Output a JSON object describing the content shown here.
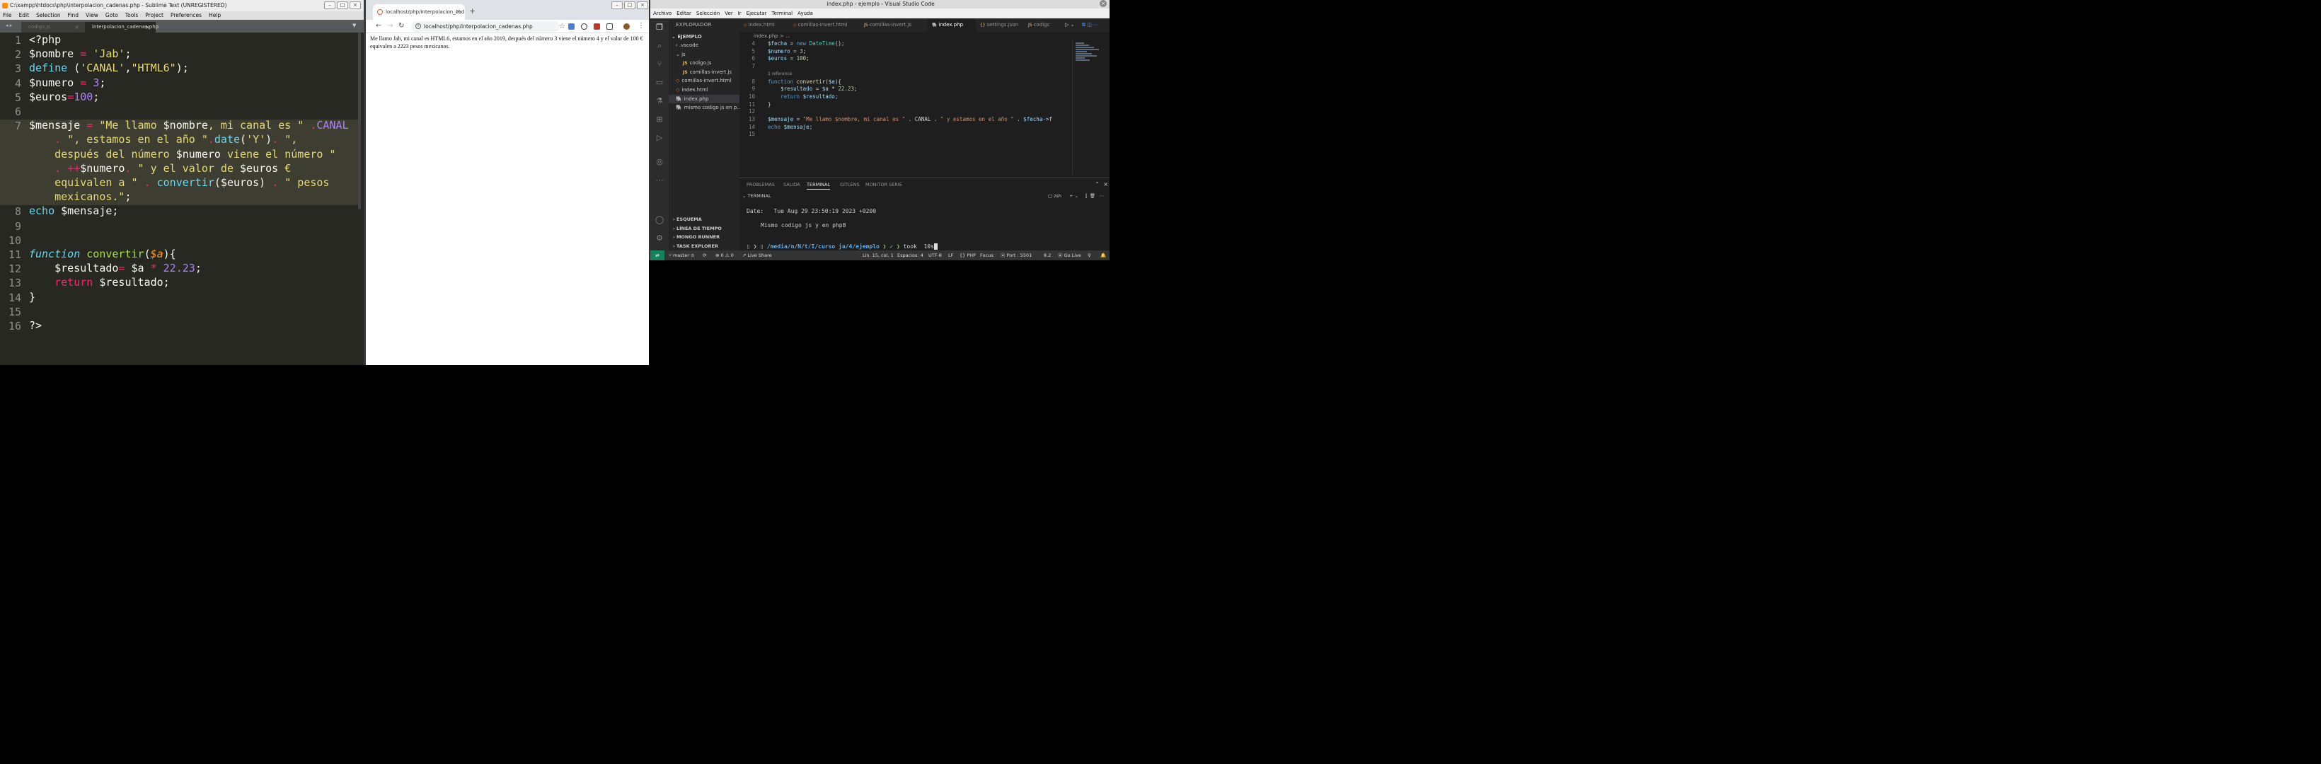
{
  "sublime": {
    "title": "C:\\xampp\\htdocs\\php\\interpolacion_cadenas.php - Sublime Text (UNREGISTERED)",
    "menu": [
      "File",
      "Edit",
      "Selection",
      "Find",
      "View",
      "Goto",
      "Tools",
      "Project",
      "Preferences",
      "Help"
    ],
    "tabs": [
      {
        "label": "codigo.js",
        "active": false
      },
      {
        "label": "interpolacion_cadenas.php",
        "active": true
      }
    ],
    "lines": [
      {
        "n": "1",
        "rows": [
          [
            [
              "v",
              "<?php"
            ]
          ]
        ]
      },
      {
        "n": "2",
        "rows": [
          [
            [
              "v",
              "$nombre "
            ],
            [
              "o",
              "="
            ],
            [
              "v",
              " "
            ],
            [
              "s",
              "'Jab'"
            ],
            [
              "v",
              ";"
            ]
          ]
        ]
      },
      {
        "n": "3",
        "rows": [
          [
            [
              "f",
              "define"
            ],
            [
              "v",
              " ("
            ],
            [
              "s",
              "'CANAL'"
            ],
            [
              "v",
              ","
            ],
            [
              "s",
              "\"HTML6\""
            ],
            [
              "v",
              ");"
            ]
          ]
        ]
      },
      {
        "n": "4",
        "rows": [
          [
            [
              "v",
              "$numero "
            ],
            [
              "o",
              "="
            ],
            [
              "v",
              " "
            ],
            [
              "c",
              "3"
            ],
            [
              "v",
              ";"
            ]
          ]
        ]
      },
      {
        "n": "5",
        "rows": [
          [
            [
              "v",
              "$euros"
            ],
            [
              "o",
              "="
            ],
            [
              "c",
              "100"
            ],
            [
              "v",
              ";"
            ]
          ]
        ]
      },
      {
        "n": "6",
        "rows": [
          [
            [
              "v",
              ""
            ]
          ]
        ]
      },
      {
        "n": "7",
        "rows": [
          [
            [
              "v",
              "$mensaje "
            ],
            [
              "o",
              "="
            ],
            [
              "v",
              " "
            ],
            [
              "s",
              "\"Me llamo "
            ],
            [
              "v",
              "$nombre"
            ],
            [
              "s",
              ", mi canal es \""
            ],
            [
              "v",
              " "
            ],
            [
              "o",
              "."
            ],
            [
              "c",
              "CANAL"
            ]
          ],
          [
            [
              "v",
              "    "
            ],
            [
              "o",
              "."
            ],
            [
              "v",
              " "
            ],
            [
              "s",
              "\", estamos en el año \""
            ],
            [
              "o",
              "."
            ],
            [
              "f",
              "date"
            ],
            [
              "v",
              "("
            ],
            [
              "s",
              "'Y'"
            ],
            [
              "v",
              ")"
            ],
            [
              "o",
              "."
            ],
            [
              "v",
              " "
            ],
            [
              "s",
              "\","
            ]
          ],
          [
            [
              "s",
              "    después del número "
            ],
            [
              "v",
              "$numero"
            ],
            [
              "s",
              " viene el número \""
            ]
          ],
          [
            [
              "v",
              "    "
            ],
            [
              "o",
              "."
            ],
            [
              "v",
              " "
            ],
            [
              "o",
              "++"
            ],
            [
              "v",
              "$numero"
            ],
            [
              "o",
              "."
            ],
            [
              "v",
              " "
            ],
            [
              "s",
              "\" y el valor de "
            ],
            [
              "v",
              "$euros"
            ],
            [
              "s",
              " €"
            ]
          ],
          [
            [
              "s",
              "    equivalen a \""
            ],
            [
              "v",
              " "
            ],
            [
              "o",
              "."
            ],
            [
              "v",
              " "
            ],
            [
              "f",
              "convertir"
            ],
            [
              "v",
              "($euros) "
            ],
            [
              "o",
              "."
            ],
            [
              "v",
              " "
            ],
            [
              "s",
              "\" pesos"
            ]
          ],
          [
            [
              "s",
              "    mexicanos.\""
            ],
            [
              "v",
              ";"
            ]
          ]
        ]
      },
      {
        "n": "8",
        "rows": [
          [
            [
              "f",
              "echo"
            ],
            [
              "v",
              " $mensaje;"
            ]
          ]
        ]
      },
      {
        "n": "9",
        "rows": [
          [
            [
              "v",
              ""
            ]
          ]
        ]
      },
      {
        "n": "10",
        "rows": [
          [
            [
              "v",
              ""
            ]
          ]
        ]
      },
      {
        "n": "11",
        "rows": [
          [
            [
              "fi",
              "function"
            ],
            [
              "v",
              " "
            ],
            [
              "g",
              "convertir"
            ],
            [
              "v",
              "("
            ],
            [
              "pa",
              "$a"
            ],
            [
              "v",
              "){"
            ]
          ]
        ]
      },
      {
        "n": "12",
        "rows": [
          [
            [
              "v",
              "    $resultado"
            ],
            [
              "o",
              "="
            ],
            [
              "v",
              " $a "
            ],
            [
              "o",
              "*"
            ],
            [
              "v",
              " "
            ],
            [
              "c",
              "22.23"
            ],
            [
              "v",
              ";"
            ]
          ]
        ]
      },
      {
        "n": "13",
        "rows": [
          [
            [
              "v",
              "    "
            ],
            [
              "k",
              "return"
            ],
            [
              "v",
              " $resultado;"
            ]
          ]
        ]
      },
      {
        "n": "14",
        "rows": [
          [
            [
              "v",
              "}"
            ]
          ]
        ]
      },
      {
        "n": "15",
        "rows": [
          [
            [
              "v",
              ""
            ]
          ]
        ]
      },
      {
        "n": "16",
        "rows": [
          [
            [
              "v",
              "?>"
            ]
          ]
        ]
      }
    ]
  },
  "browser": {
    "tab_title": "localhost/php/interpolacion_cad",
    "url": "localhost/php/interpolacion_cadenas.php",
    "page_text": "Me llamo Jab, mi canal es HTML6, estamos en el año 2019, después del número 3 viene el número 4 y el valor de 100 € equivalen a 2223 pesos mexicanos."
  },
  "vscode": {
    "title": "index.php - ejemplo - Visual Studio Code",
    "menu": [
      "Archivo",
      "Editar",
      "Selección",
      "Ver",
      "Ir",
      "Ejecutar",
      "Terminal",
      "Ayuda"
    ],
    "explorer_title": "EXPLORADOR",
    "workspace": "EJEMPLO",
    "tree": [
      {
        "label": "› .vscode",
        "kind": "folder",
        "indent": 1
      },
      {
        "label": "⌄ js",
        "kind": "folder",
        "indent": 1
      },
      {
        "label": "codigo.js",
        "kind": "js",
        "indent": 2
      },
      {
        "label": "comillas-invert.js",
        "kind": "js",
        "indent": 2
      },
      {
        "label": "comillas-invert.html",
        "kind": "html",
        "indent": 1
      },
      {
        "label": "index.html",
        "kind": "html",
        "indent": 1
      },
      {
        "label": "index.php",
        "kind": "php",
        "indent": 1,
        "selected": true
      },
      {
        "label": "mismo codigo js en p...",
        "kind": "php",
        "indent": 1
      }
    ],
    "sections": [
      "ESQUEMA",
      "LÍNEA DE TIEMPO",
      "MONGO RUNNER",
      "TASK EXPLORER"
    ],
    "tabs": [
      {
        "label": "index.html",
        "kind": "html"
      },
      {
        "label": "comillas-invert.html",
        "kind": "html"
      },
      {
        "label": "comillas-invert.js",
        "kind": "js"
      },
      {
        "label": "index.php",
        "kind": "php",
        "active": true
      },
      {
        "label": "settings.json",
        "kind": "json"
      },
      {
        "label": "codigc",
        "kind": "js"
      }
    ],
    "breadcrumb": "index.php > ...",
    "codelens": "1 reference",
    "lines": [
      {
        "n": "4",
        "t": [
          [
            "vv",
            "$fecha"
          ],
          [
            "vp",
            " = "
          ],
          [
            "vk",
            "new"
          ],
          [
            "vp",
            " "
          ],
          [
            "vc",
            "DateTime"
          ],
          [
            "vp",
            "();"
          ]
        ]
      },
      {
        "n": "5",
        "t": [
          [
            "vv",
            "$numero"
          ],
          [
            "vp",
            " = "
          ],
          [
            "vn",
            "3"
          ],
          [
            "vp",
            ";"
          ]
        ]
      },
      {
        "n": "6",
        "t": [
          [
            "vv",
            "$euros"
          ],
          [
            "vp",
            " = "
          ],
          [
            "vn",
            "100"
          ],
          [
            "vp",
            ";"
          ]
        ]
      },
      {
        "n": "7",
        "t": [
          [
            "vp",
            ""
          ]
        ]
      },
      {
        "n": "8",
        "t": [
          [
            "vk",
            "function"
          ],
          [
            "vp",
            " "
          ],
          [
            "vf",
            "convertir"
          ],
          [
            "vp",
            "("
          ],
          [
            "vv",
            "$a"
          ],
          [
            "vp",
            "){"
          ]
        ]
      },
      {
        "n": "9",
        "t": [
          [
            "vp",
            "    "
          ],
          [
            "vv",
            "$resultado"
          ],
          [
            "vp",
            " = "
          ],
          [
            "vv",
            "$a"
          ],
          [
            "vp",
            " * "
          ],
          [
            "vn",
            "22.23"
          ],
          [
            "vp",
            ";"
          ]
        ]
      },
      {
        "n": "10",
        "t": [
          [
            "vp",
            "    "
          ],
          [
            "vk",
            "return"
          ],
          [
            "vp",
            " "
          ],
          [
            "vv",
            "$resultado"
          ],
          [
            "vp",
            ";"
          ]
        ]
      },
      {
        "n": "11",
        "t": [
          [
            "vp",
            "}"
          ]
        ]
      },
      {
        "n": "12",
        "t": [
          [
            "vp",
            ""
          ]
        ]
      },
      {
        "n": "13",
        "t": [
          [
            "vv",
            "$mensaje"
          ],
          [
            "vp",
            " = "
          ],
          [
            "vs",
            "\"Me llamo $nombre, mi canal es \""
          ],
          [
            "vp",
            " . CANAL . "
          ],
          [
            "vs",
            "\" y estamos en el año \""
          ],
          [
            "vp",
            " . "
          ],
          [
            "vv",
            "$fecha"
          ],
          [
            "vp",
            "->f"
          ]
        ]
      },
      {
        "n": "14",
        "t": [
          [
            "vk",
            "echo"
          ],
          [
            "vp",
            " "
          ],
          [
            "vv",
            "$mensaje"
          ],
          [
            "vp",
            ";"
          ]
        ]
      },
      {
        "n": "15",
        "t": [
          [
            "vp",
            ""
          ]
        ]
      }
    ],
    "panel_tabs": [
      "PROBLEMAS",
      "SALIDA",
      "TERMINAL",
      "GITLENS",
      "MONITOR SERIE"
    ],
    "terminal_label": "TERMINAL",
    "shell": "zsh",
    "terminal": {
      "date_line": "Date:   Tue Aug 29 23:50:19 2023 +0200",
      "echo_line": "Mismo codigo js y en php8",
      "path": "/media/n/N/t/I/curso ja/4/ejemplo",
      "took": "took  10s"
    },
    "status": {
      "branch": "master",
      "problems": "⊗ 0 ⚠ 0",
      "live_share": "Live Share",
      "position": "Lín. 15, col. 1",
      "spaces": "Espacios: 4",
      "encoding": "UTF-8",
      "eol": "LF",
      "language": "PHP",
      "focus": "Focus:",
      "port": "Port : 5501",
      "version": "8.2",
      "go_live": "Go Live"
    }
  }
}
